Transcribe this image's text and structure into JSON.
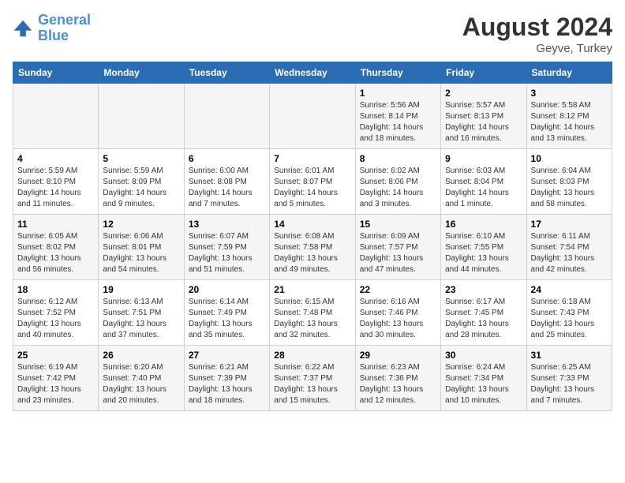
{
  "header": {
    "logo_line1": "General",
    "logo_line2": "Blue",
    "month_year": "August 2024",
    "location": "Geyve, Turkey"
  },
  "days_of_week": [
    "Sunday",
    "Monday",
    "Tuesday",
    "Wednesday",
    "Thursday",
    "Friday",
    "Saturday"
  ],
  "weeks": [
    [
      {
        "day": "",
        "info": ""
      },
      {
        "day": "",
        "info": ""
      },
      {
        "day": "",
        "info": ""
      },
      {
        "day": "",
        "info": ""
      },
      {
        "day": "1",
        "info": "Sunrise: 5:56 AM\nSunset: 8:14 PM\nDaylight: 14 hours\nand 18 minutes."
      },
      {
        "day": "2",
        "info": "Sunrise: 5:57 AM\nSunset: 8:13 PM\nDaylight: 14 hours\nand 16 minutes."
      },
      {
        "day": "3",
        "info": "Sunrise: 5:58 AM\nSunset: 8:12 PM\nDaylight: 14 hours\nand 13 minutes."
      }
    ],
    [
      {
        "day": "4",
        "info": "Sunrise: 5:59 AM\nSunset: 8:10 PM\nDaylight: 14 hours\nand 11 minutes."
      },
      {
        "day": "5",
        "info": "Sunrise: 5:59 AM\nSunset: 8:09 PM\nDaylight: 14 hours\nand 9 minutes."
      },
      {
        "day": "6",
        "info": "Sunrise: 6:00 AM\nSunset: 8:08 PM\nDaylight: 14 hours\nand 7 minutes."
      },
      {
        "day": "7",
        "info": "Sunrise: 6:01 AM\nSunset: 8:07 PM\nDaylight: 14 hours\nand 5 minutes."
      },
      {
        "day": "8",
        "info": "Sunrise: 6:02 AM\nSunset: 8:06 PM\nDaylight: 14 hours\nand 3 minutes."
      },
      {
        "day": "9",
        "info": "Sunrise: 6:03 AM\nSunset: 8:04 PM\nDaylight: 14 hours\nand 1 minute."
      },
      {
        "day": "10",
        "info": "Sunrise: 6:04 AM\nSunset: 8:03 PM\nDaylight: 13 hours\nand 58 minutes."
      }
    ],
    [
      {
        "day": "11",
        "info": "Sunrise: 6:05 AM\nSunset: 8:02 PM\nDaylight: 13 hours\nand 56 minutes."
      },
      {
        "day": "12",
        "info": "Sunrise: 6:06 AM\nSunset: 8:01 PM\nDaylight: 13 hours\nand 54 minutes."
      },
      {
        "day": "13",
        "info": "Sunrise: 6:07 AM\nSunset: 7:59 PM\nDaylight: 13 hours\nand 51 minutes."
      },
      {
        "day": "14",
        "info": "Sunrise: 6:08 AM\nSunset: 7:58 PM\nDaylight: 13 hours\nand 49 minutes."
      },
      {
        "day": "15",
        "info": "Sunrise: 6:09 AM\nSunset: 7:57 PM\nDaylight: 13 hours\nand 47 minutes."
      },
      {
        "day": "16",
        "info": "Sunrise: 6:10 AM\nSunset: 7:55 PM\nDaylight: 13 hours\nand 44 minutes."
      },
      {
        "day": "17",
        "info": "Sunrise: 6:11 AM\nSunset: 7:54 PM\nDaylight: 13 hours\nand 42 minutes."
      }
    ],
    [
      {
        "day": "18",
        "info": "Sunrise: 6:12 AM\nSunset: 7:52 PM\nDaylight: 13 hours\nand 40 minutes."
      },
      {
        "day": "19",
        "info": "Sunrise: 6:13 AM\nSunset: 7:51 PM\nDaylight: 13 hours\nand 37 minutes."
      },
      {
        "day": "20",
        "info": "Sunrise: 6:14 AM\nSunset: 7:49 PM\nDaylight: 13 hours\nand 35 minutes."
      },
      {
        "day": "21",
        "info": "Sunrise: 6:15 AM\nSunset: 7:48 PM\nDaylight: 13 hours\nand 32 minutes."
      },
      {
        "day": "22",
        "info": "Sunrise: 6:16 AM\nSunset: 7:46 PM\nDaylight: 13 hours\nand 30 minutes."
      },
      {
        "day": "23",
        "info": "Sunrise: 6:17 AM\nSunset: 7:45 PM\nDaylight: 13 hours\nand 28 minutes."
      },
      {
        "day": "24",
        "info": "Sunrise: 6:18 AM\nSunset: 7:43 PM\nDaylight: 13 hours\nand 25 minutes."
      }
    ],
    [
      {
        "day": "25",
        "info": "Sunrise: 6:19 AM\nSunset: 7:42 PM\nDaylight: 13 hours\nand 23 minutes."
      },
      {
        "day": "26",
        "info": "Sunrise: 6:20 AM\nSunset: 7:40 PM\nDaylight: 13 hours\nand 20 minutes."
      },
      {
        "day": "27",
        "info": "Sunrise: 6:21 AM\nSunset: 7:39 PM\nDaylight: 13 hours\nand 18 minutes."
      },
      {
        "day": "28",
        "info": "Sunrise: 6:22 AM\nSunset: 7:37 PM\nDaylight: 13 hours\nand 15 minutes."
      },
      {
        "day": "29",
        "info": "Sunrise: 6:23 AM\nSunset: 7:36 PM\nDaylight: 13 hours\nand 12 minutes."
      },
      {
        "day": "30",
        "info": "Sunrise: 6:24 AM\nSunset: 7:34 PM\nDaylight: 13 hours\nand 10 minutes."
      },
      {
        "day": "31",
        "info": "Sunrise: 6:25 AM\nSunset: 7:33 PM\nDaylight: 13 hours\nand 7 minutes."
      }
    ]
  ]
}
